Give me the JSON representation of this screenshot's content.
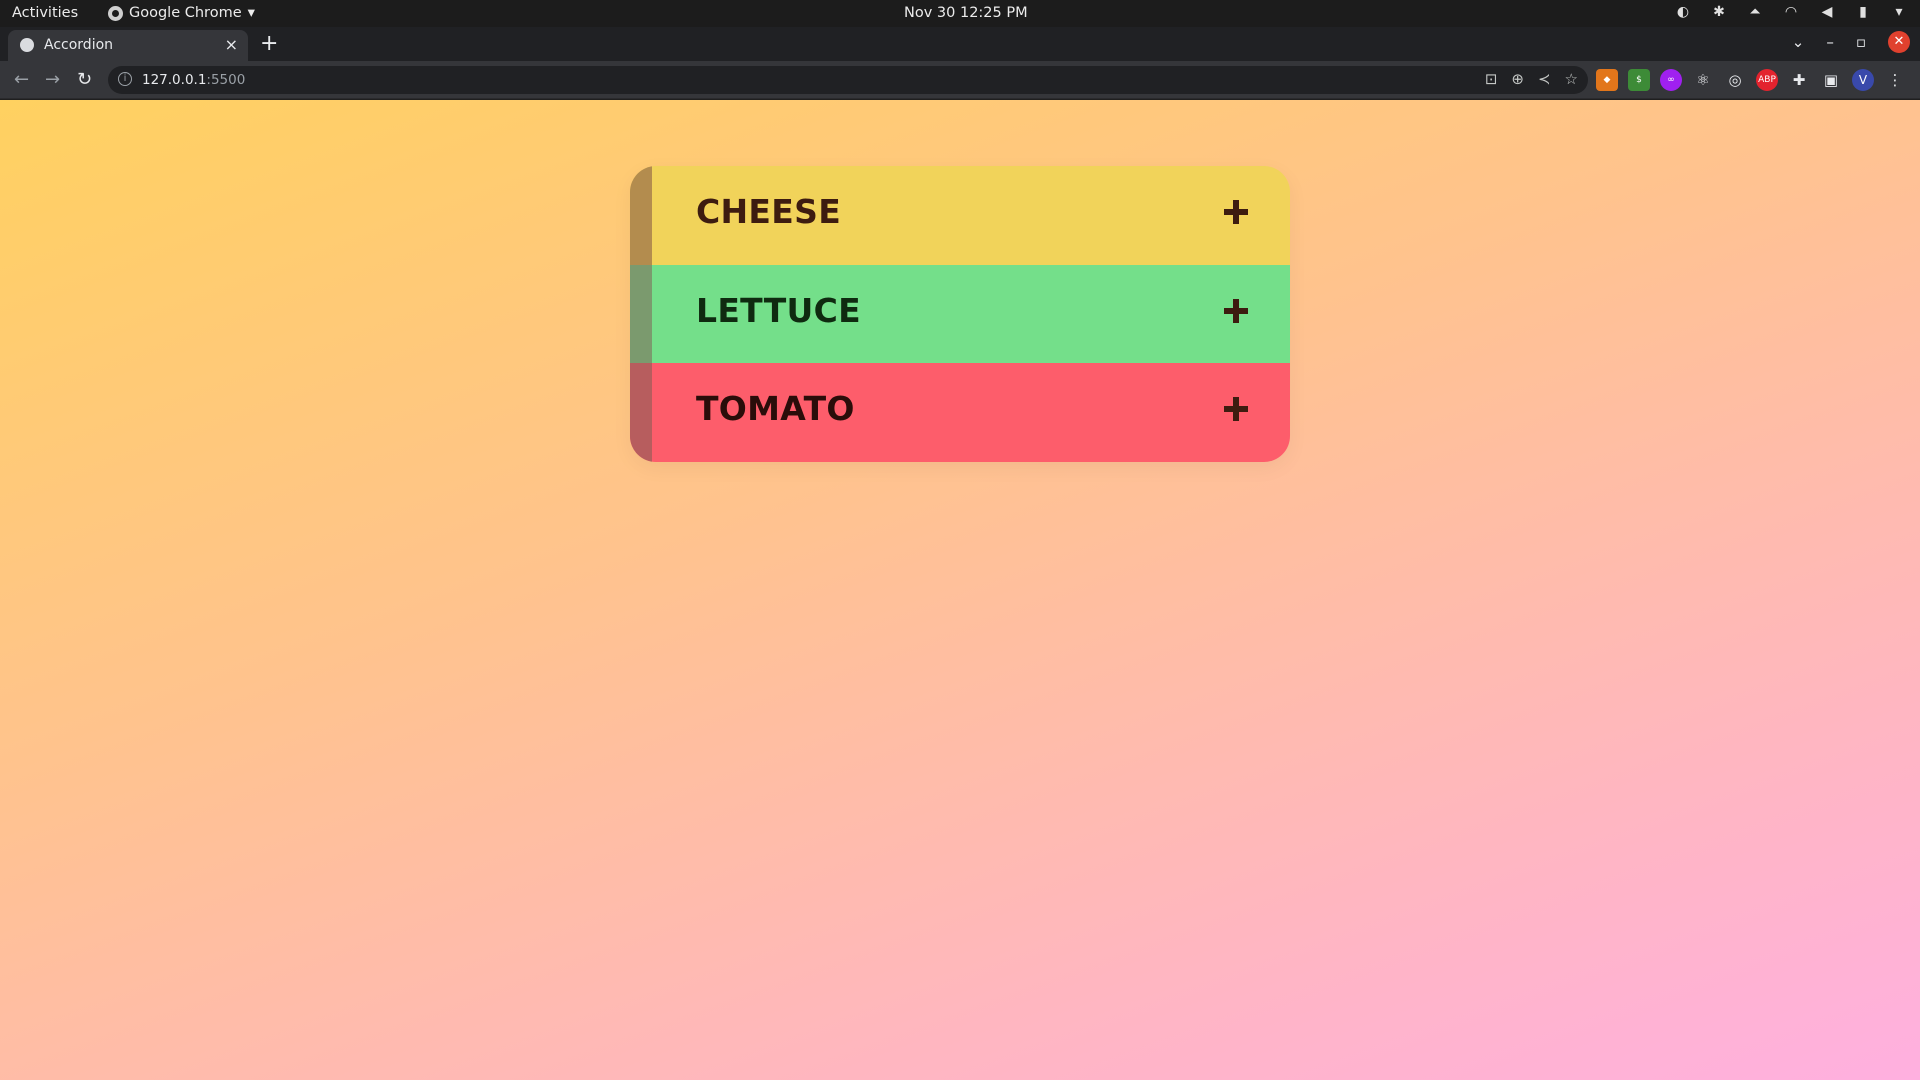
{
  "system_bar": {
    "activities": "Activities",
    "app_name": "Google Chrome",
    "clock": "Nov 30  12:25 PM"
  },
  "browser": {
    "tab_title": "Accordion",
    "url_host": "127.0.0.1",
    "url_port": ":5500"
  },
  "accordion": {
    "items": [
      {
        "label": "CHEESE",
        "bg": "#f1d35a",
        "stripe": "#b38c4e",
        "text_color": "#3d1c10",
        "expanded": false
      },
      {
        "label": "LETTUCE",
        "bg": "#74df8a",
        "stripe": "#7b9a6e",
        "text_color": "#0f2a10",
        "expanded": false
      },
      {
        "label": "TOMATO",
        "bg": "#fd5d6b",
        "stripe": "#b75d5e",
        "text_color": "#2a0d0a",
        "expanded": false
      }
    ]
  }
}
